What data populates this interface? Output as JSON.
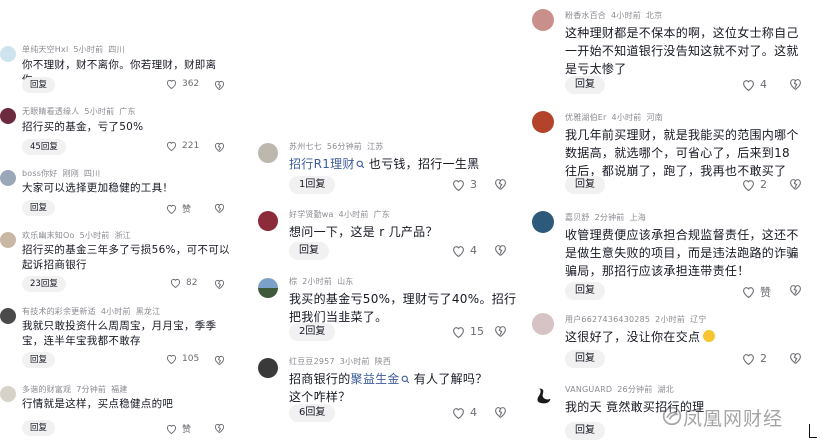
{
  "left": [
    {
      "user": "单纯天空Hxl",
      "time": "5小时前",
      "loc": "四川",
      "text": "你不理财，财不离你。你若理财，财即离你。",
      "reply": "回复",
      "likes": "362"
    },
    {
      "user": "无眼睛看透缘人",
      "time": "5小时前",
      "loc": "广东",
      "text": "招行买的基金，亏了50%",
      "reply": "45回复",
      "likes": "221"
    },
    {
      "user": "boss你好",
      "time": "刚刚",
      "loc": "四川",
      "text": "大家可以选择更加稳健的工具！",
      "reply": "回复",
      "likes": "赞"
    },
    {
      "user": "欢乐幽末知Oo",
      "time": "5小时前",
      "loc": "浙江",
      "text": "招行买的基金三年多了亏损56%，可不可以起诉招商银行",
      "reply": "23回复",
      "likes": "82"
    },
    {
      "user": "有技术的彩余更新适",
      "time": "4小时前",
      "loc": "黑龙江",
      "text": "我就只敢投资什么周周宝，月月宝，季季宝，连半年宝我都不敢存",
      "reply": "回复",
      "likes": "105"
    },
    {
      "user": "多谐的财富观",
      "time": "7分钟前",
      "loc": "福建",
      "text": "行情就是这样，买点稳健点的吧",
      "reply": "回复",
      "likes": "赞"
    }
  ],
  "mid": [
    {
      "user": "苏州七七",
      "time": "56分钟前",
      "loc": "江苏",
      "text_pre": "",
      "tag": "招行R1理财",
      "text_post": "也亏钱，招行一生黑",
      "reply": "1回复",
      "likes": "3"
    },
    {
      "user": "好学贤勤wa",
      "time": "4小时前",
      "loc": "广东",
      "text_pre": "想问一下，这是 r 几产品？",
      "tag": "",
      "text_post": "",
      "reply": "回复",
      "likes": "4"
    },
    {
      "user": "棕",
      "time": "2小时前",
      "loc": "山东",
      "text_pre": "我买的基金亏50%，理财亏了40%。招行把我们当韭菜了。",
      "tag": "",
      "text_post": "",
      "reply": "2回复",
      "likes": "15"
    },
    {
      "user": "红豆豆2957",
      "time": "3小时前",
      "loc": "陕西",
      "text_pre": "招商银行的",
      "tag": "聚益生金",
      "text_post": "有人了解吗？这个咋样？",
      "reply": "6回复",
      "likes": "4"
    }
  ],
  "right": [
    {
      "user": "粉香水百合",
      "time": "4小时前",
      "loc": "北京",
      "text": "这种理财都是不保本的啊，这位女士称自己一开始不知道银行没告知这就不对了。这就是亏太惨了",
      "reply": "回复",
      "likes": "4"
    },
    {
      "user": "优雅湖伯Er",
      "time": "4小时前",
      "loc": "河南",
      "text": "我几年前买理财，就是我能买的范围内哪个数据高，就选哪个，可省心了，后来到18往后，都说崩了，跑了，我再也不敢买了",
      "reply": "回复",
      "likes": "2"
    },
    {
      "user": "嘉贝舒",
      "time": "2分钟前",
      "loc": "上海",
      "text": "收管理费便应该承担合规监督责任，这还不是做生意失败的项目，而是违法跑路的诈骗骗局，那招行应该承担连带责任！",
      "reply": "回复",
      "likes": "赞"
    },
    {
      "user": "用户6627436430285",
      "time": "2小时前",
      "loc": "辽宁",
      "text": "这很好了，没让你在交点",
      "reply": "回复",
      "likes": "2"
    },
    {
      "user": "VANGUARD",
      "time": "26分钟前",
      "loc": "湖北",
      "text": "我的天 竟然敢买招行的理",
      "reply": "回复",
      "likes": ""
    }
  ],
  "watermark": "凤凰网财经",
  "colors": {
    "bg": "#ffffff",
    "text": "#161823",
    "meta": "#8a8b91",
    "tag": "#3e5d9a",
    "pill": "#f1f1f2"
  }
}
